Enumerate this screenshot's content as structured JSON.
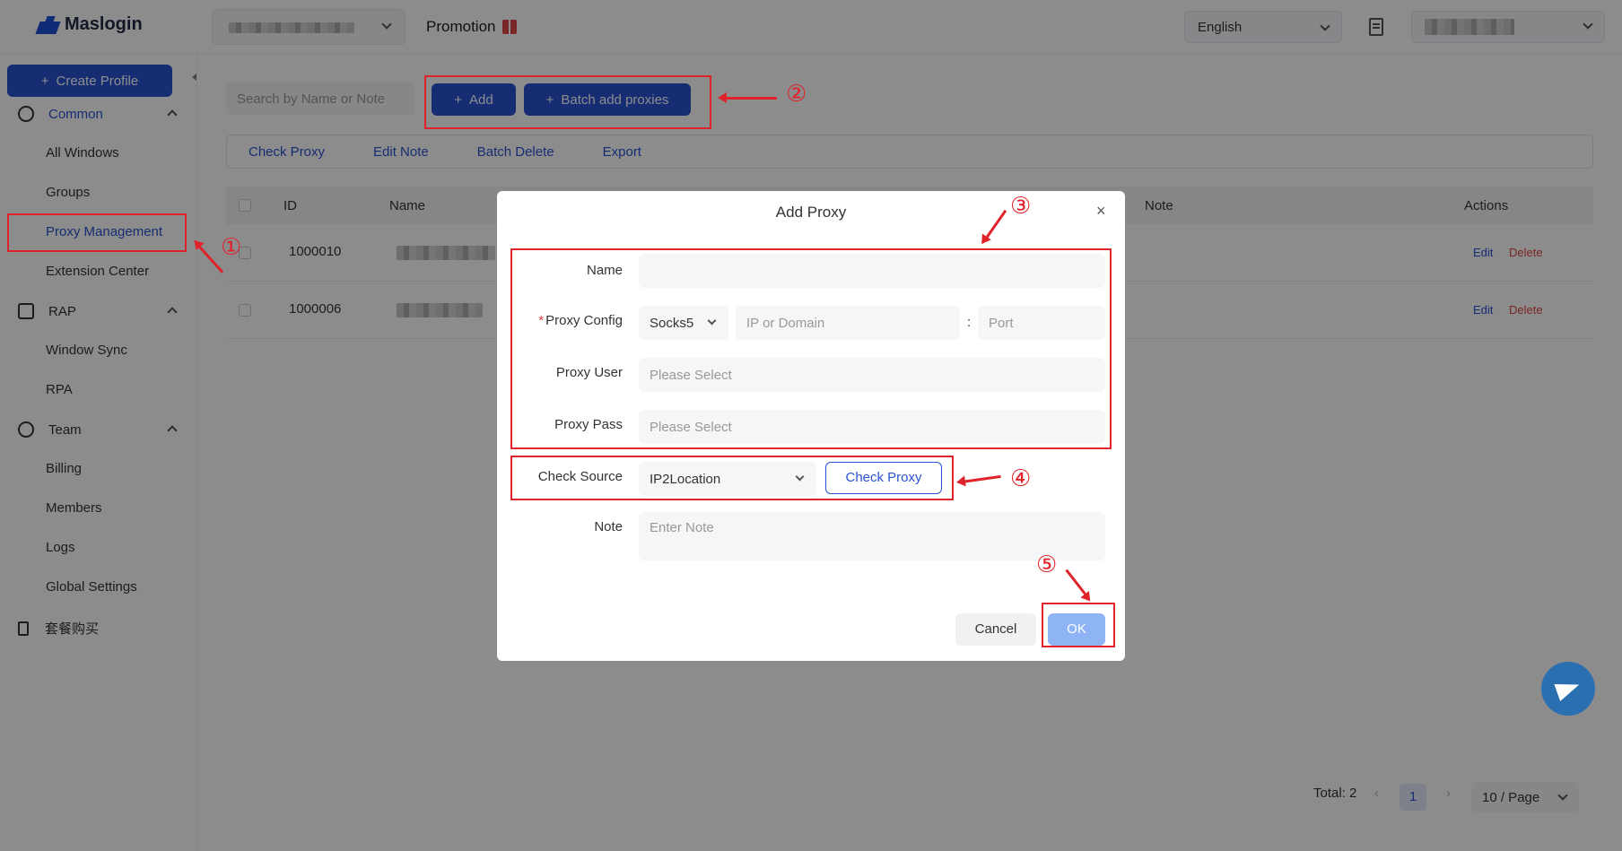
{
  "header": {
    "brand": "Maslogin",
    "promotion": "Promotion",
    "language": "English"
  },
  "sidebar": {
    "create_label": "Create Profile",
    "groups": [
      {
        "label": "Common",
        "icon": "globe-icon"
      },
      {
        "label": "RAP",
        "icon": "robot-icon"
      },
      {
        "label": "Team",
        "icon": "team-icon"
      }
    ],
    "items": {
      "all_windows": "All Windows",
      "groups": "Groups",
      "proxy_management": "Proxy Management",
      "extension_center": "Extension Center",
      "window_sync": "Window Sync",
      "rpa": "RPA",
      "billing": "Billing",
      "members": "Members",
      "logs": "Logs",
      "global_settings": "Global Settings",
      "package_purchase": "套餐购买"
    }
  },
  "main": {
    "search_placeholder": "Search by Name or Note",
    "add_label": "Add",
    "batch_label": "Batch add proxies",
    "toolbar": [
      "Check Proxy",
      "Edit Note",
      "Batch Delete",
      "Export"
    ],
    "columns": {
      "id": "ID",
      "name": "Name",
      "note": "Note",
      "actions": "Actions"
    },
    "rows": [
      {
        "id": "1000010",
        "edit": "Edit",
        "delete": "Delete"
      },
      {
        "id": "1000006",
        "edit": "Edit",
        "delete": "Delete"
      }
    ],
    "pagination": {
      "total": "Total: 2",
      "page": "1",
      "page_size": "10 / Page"
    }
  },
  "modal": {
    "title": "Add Proxy",
    "close": "×",
    "labels": {
      "name": "Name",
      "proxy_config": "Proxy Config",
      "proxy_user": "Proxy User",
      "proxy_pass": "Proxy Pass",
      "check_source": "Check Source",
      "note": "Note"
    },
    "protocol": "Socks5",
    "host_placeholder": "IP or Domain",
    "port_placeholder": "Port",
    "user_placeholder": "Please Select",
    "pass_placeholder": "Please Select",
    "check_source_value": "IP2Location",
    "check_button": "Check Proxy",
    "note_placeholder": "Enter Note",
    "cancel": "Cancel",
    "ok": "OK"
  },
  "annotations": [
    "①",
    "②",
    "③",
    "④",
    "⑤"
  ],
  "colors": {
    "accent": "#2853d4",
    "danger": "#e0454b",
    "annotation": "#e0222b"
  }
}
